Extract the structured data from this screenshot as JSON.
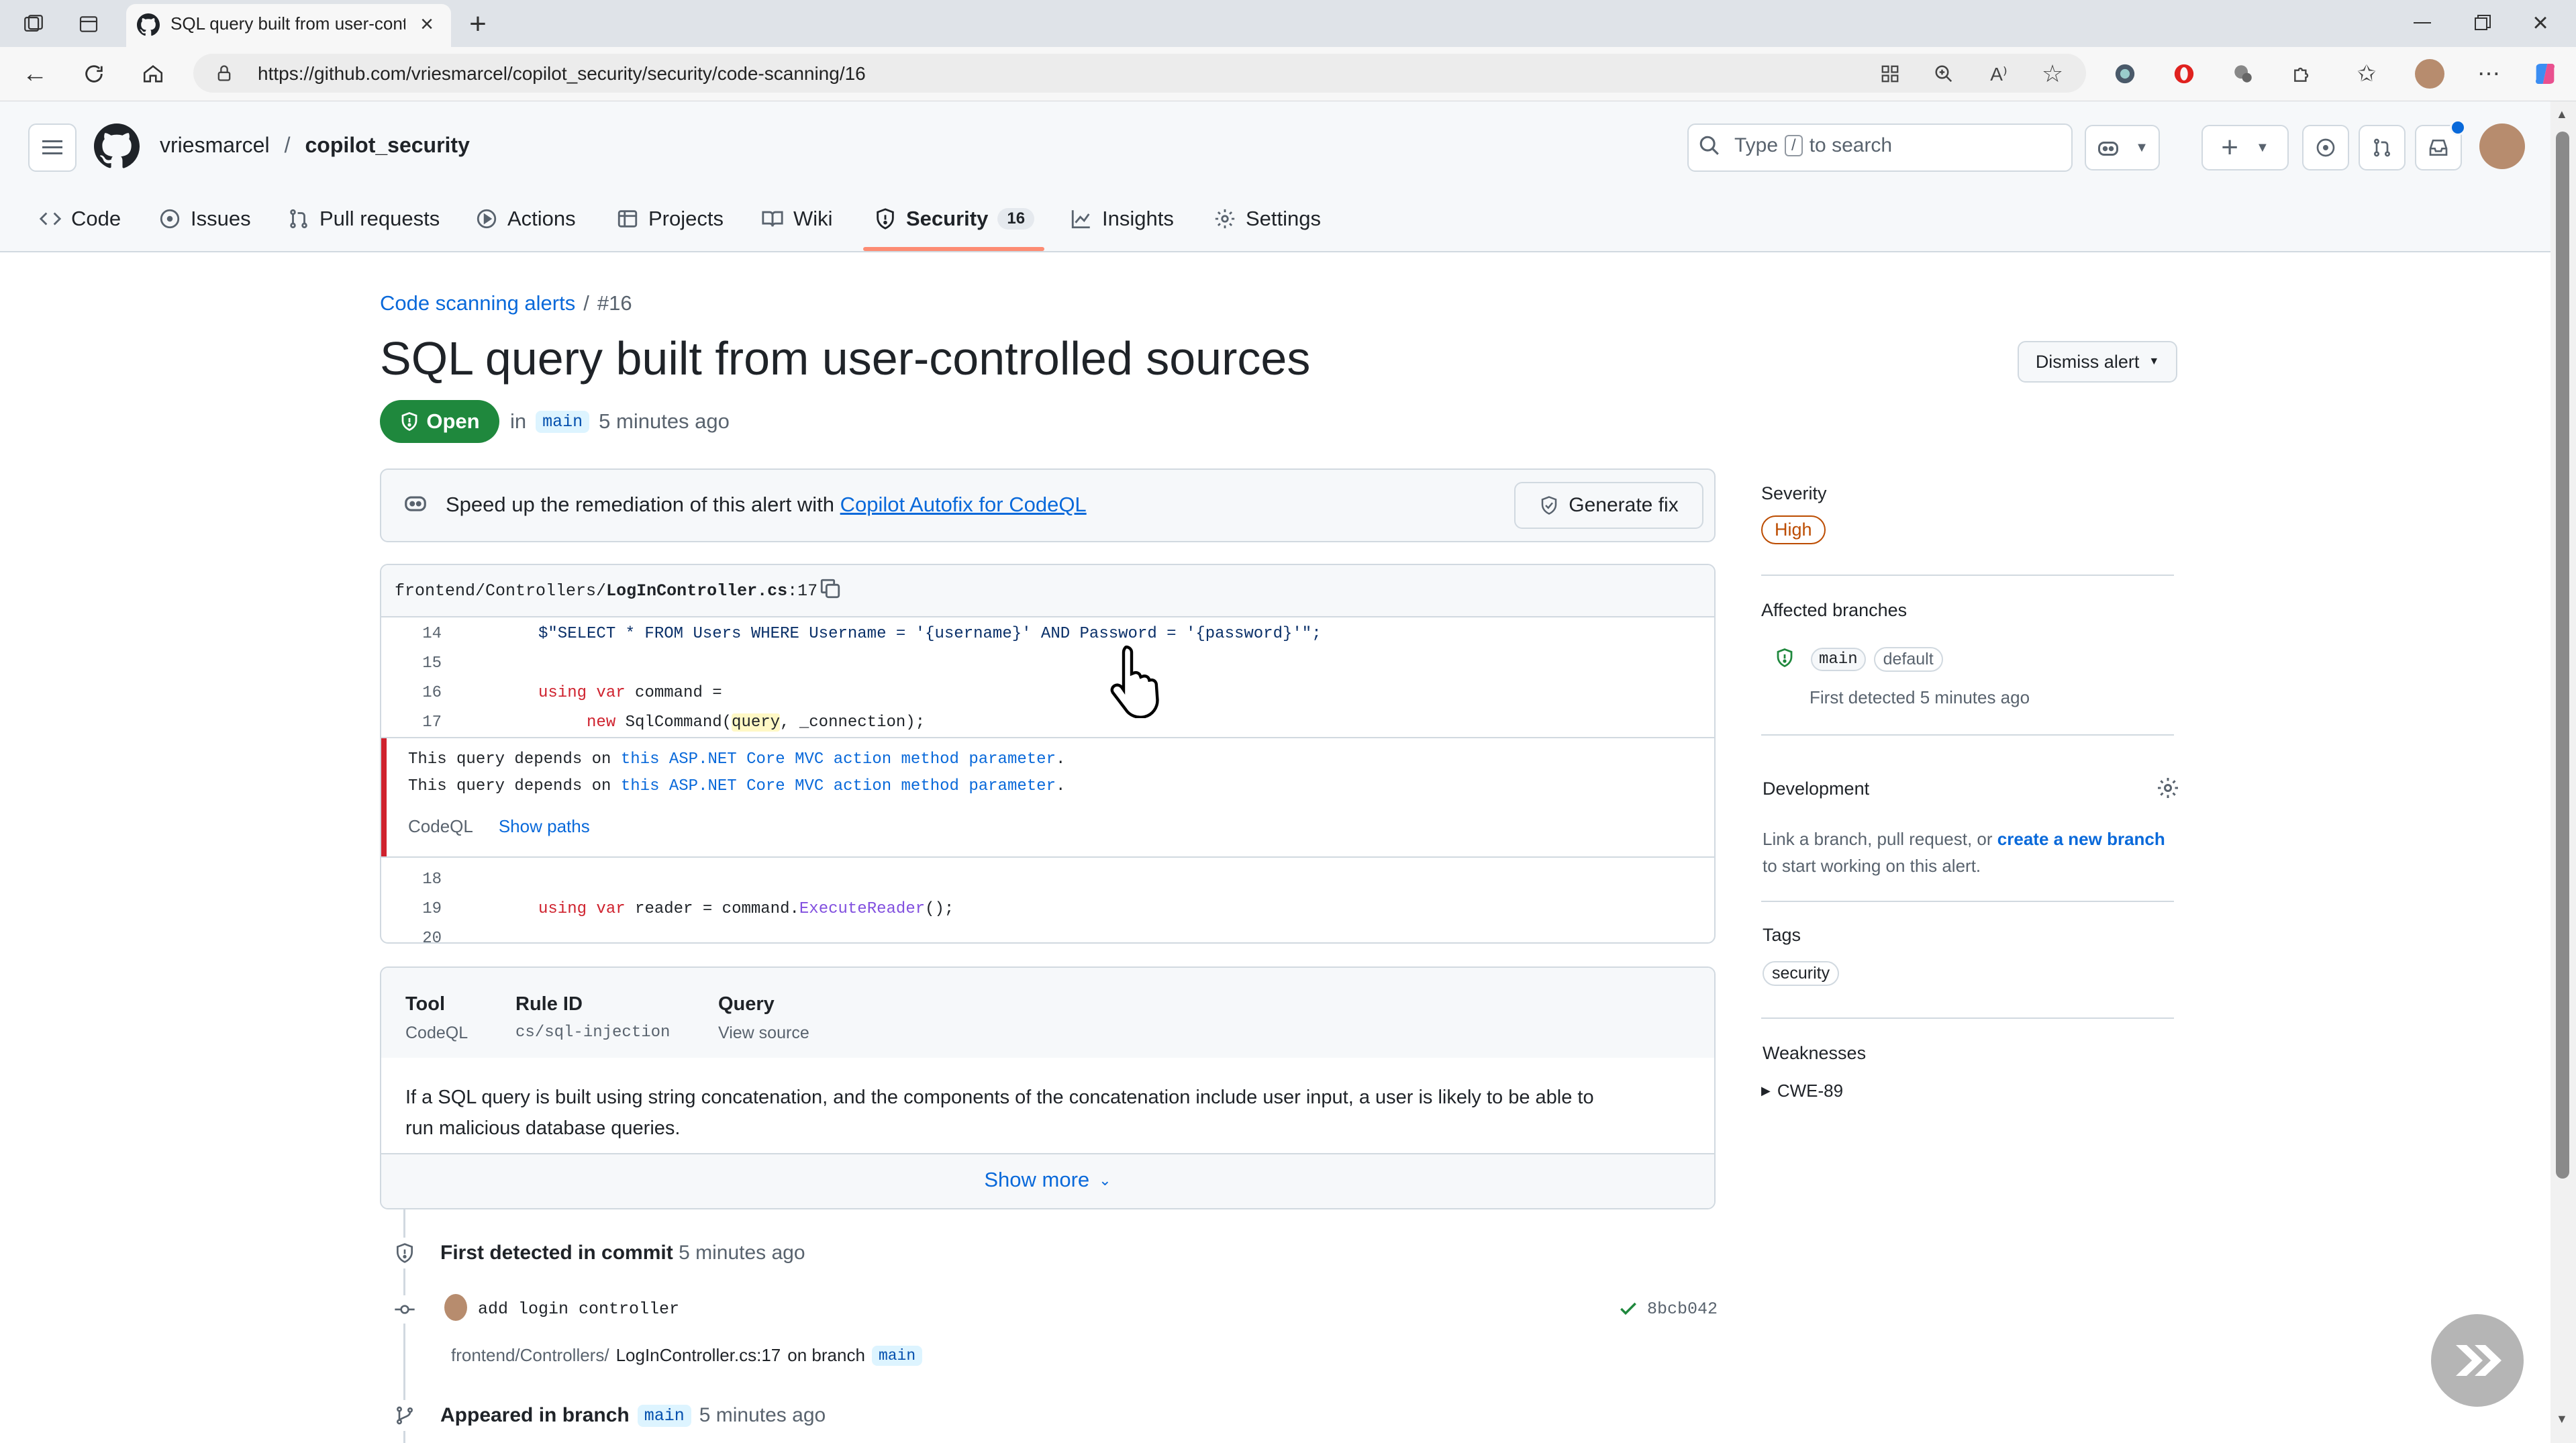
{
  "browser": {
    "tab_title": "SQL query built from user-controll",
    "url": "https://github.com/vriesmarcel/copilot_security/security/code-scanning/16"
  },
  "header": {
    "owner": "vriesmarcel",
    "separator": "/",
    "repo": "copilot_security",
    "search_text_type": "Type",
    "search_key": "/",
    "search_text_rest": "to search"
  },
  "nav": {
    "code": "Code",
    "issues": "Issues",
    "pull_requests": "Pull requests",
    "actions": "Actions",
    "projects": "Projects",
    "wiki": "Wiki",
    "security": "Security",
    "security_count": "16",
    "insights": "Insights",
    "settings": "Settings"
  },
  "alert": {
    "breadcrumb_link": "Code scanning alerts",
    "breadcrumb_sep": "/",
    "breadcrumb_num": "#16",
    "title": "SQL query built from user-controlled sources",
    "status": "Open",
    "in_text": "in",
    "branch": "main",
    "time": "5 minutes ago",
    "dismiss_label": "Dismiss alert"
  },
  "autofix": {
    "text": "Speed up the remediation of this alert with",
    "link": "Copilot Autofix for CodeQL",
    "button": "Generate fix"
  },
  "code": {
    "file_prefix": "frontend/Controllers/",
    "file_name": "LogInController.cs",
    "file_line": ":17",
    "lines": [
      {
        "num": "14",
        "segments": [
          {
            "t": "$\"SELECT * FROM Users WHERE Username = '{username}' AND Password = '{password}'\";",
            "c": "str"
          }
        ]
      },
      {
        "num": "15",
        "segments": []
      },
      {
        "num": "16",
        "segments": [
          {
            "t": "using",
            "c": "kw"
          },
          {
            "t": " ",
            "c": ""
          },
          {
            "t": "var",
            "c": "kw"
          },
          {
            "t": " command =",
            "c": ""
          }
        ]
      },
      {
        "num": "17",
        "segments": [
          {
            "t": "     new",
            "c": "kw"
          },
          {
            "t": " SqlCommand(",
            "c": ""
          },
          {
            "t": "query",
            "c": "hl"
          },
          {
            "t": ", _connection);",
            "c": ""
          }
        ]
      }
    ],
    "lines_after": [
      {
        "num": "18",
        "segments": []
      },
      {
        "num": "19",
        "segments": [
          {
            "t": "using",
            "c": "kw"
          },
          {
            "t": " ",
            "c": ""
          },
          {
            "t": "var",
            "c": "kw"
          },
          {
            "t": " reader = command.",
            "c": ""
          },
          {
            "t": "ExecuteReader",
            "c": "fn"
          },
          {
            "t": "();",
            "c": ""
          }
        ]
      },
      {
        "num": "20",
        "segments": []
      }
    ],
    "message_prefix": "This query depends on",
    "message_link": "this ASP.NET Core MVC action method parameter",
    "message_suffix": ".",
    "tool_label": "CodeQL",
    "show_paths": "Show paths"
  },
  "details": {
    "tool_head": "Tool",
    "tool_val": "CodeQL",
    "rule_head": "Rule ID",
    "rule_val": "cs/sql-injection",
    "query_head": "Query",
    "query_val": "View source",
    "description_1": "If a SQL query is built using string concatenation, and the components of the concatenation include user input, a user is likely to be able to",
    "description_2": "run malicious database queries.",
    "show_more": "Show more"
  },
  "timeline": {
    "first_detected": "First detected in commit",
    "first_time": "5 minutes ago",
    "commit_msg": "add login controller",
    "commit_sha": "8bcb042",
    "path_prefix": "frontend/Controllers/",
    "path_file": "LogInController.cs:17",
    "on_branch": "on branch",
    "branch": "main",
    "appeared": "Appeared in branch",
    "appeared_branch": "main",
    "appeared_time": "5 minutes ago"
  },
  "sidebar": {
    "severity_title": "Severity",
    "severity": "High",
    "affected_title": "Affected branches",
    "branch": "main",
    "default_label": "default",
    "first_detected": "First detected 5 minutes ago",
    "development_title": "Development",
    "dev_text_1": "Link a branch, pull request, or",
    "dev_link": "create a new branch",
    "dev_text_2": "to start working on this alert.",
    "tags_title": "Tags",
    "tag": "security",
    "weaknesses_title": "Weaknesses",
    "weakness": "CWE-89"
  },
  "colors": {
    "accent": "#0969da",
    "open_green": "#1f883d",
    "severity": "#bc4c00",
    "underline": "#fd8c73"
  }
}
